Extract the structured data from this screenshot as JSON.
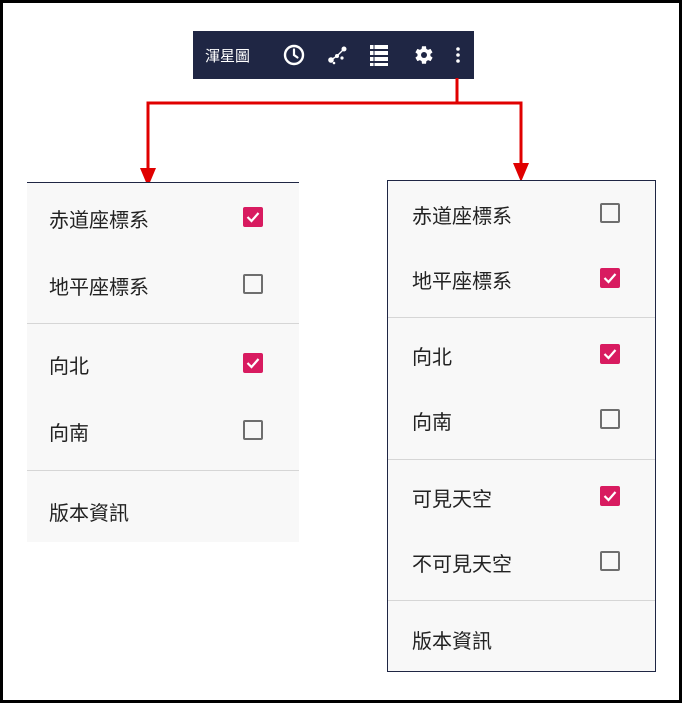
{
  "toolbar": {
    "title": "渾星圖",
    "icons": [
      "clock-icon",
      "constellation-icon",
      "list-icon",
      "gear-icon",
      "more-vert-icon"
    ]
  },
  "colors": {
    "toolbar_bg": "#1f2644",
    "accent": "#d81b60",
    "arrow": "#e00000"
  },
  "left_menu": {
    "items": [
      {
        "label": "赤道座標系",
        "checked": true
      },
      {
        "label": "地平座標系",
        "checked": false
      },
      {
        "label": "向北",
        "checked": true
      },
      {
        "label": "向南",
        "checked": false
      },
      {
        "label": "版本資訊"
      }
    ]
  },
  "right_menu": {
    "items": [
      {
        "label": "赤道座標系",
        "checked": false
      },
      {
        "label": "地平座標系",
        "checked": true
      },
      {
        "label": "向北",
        "checked": true
      },
      {
        "label": "向南",
        "checked": false
      },
      {
        "label": "可見天空",
        "checked": true
      },
      {
        "label": "不可見天空",
        "checked": false
      },
      {
        "label": "版本資訊"
      }
    ]
  }
}
